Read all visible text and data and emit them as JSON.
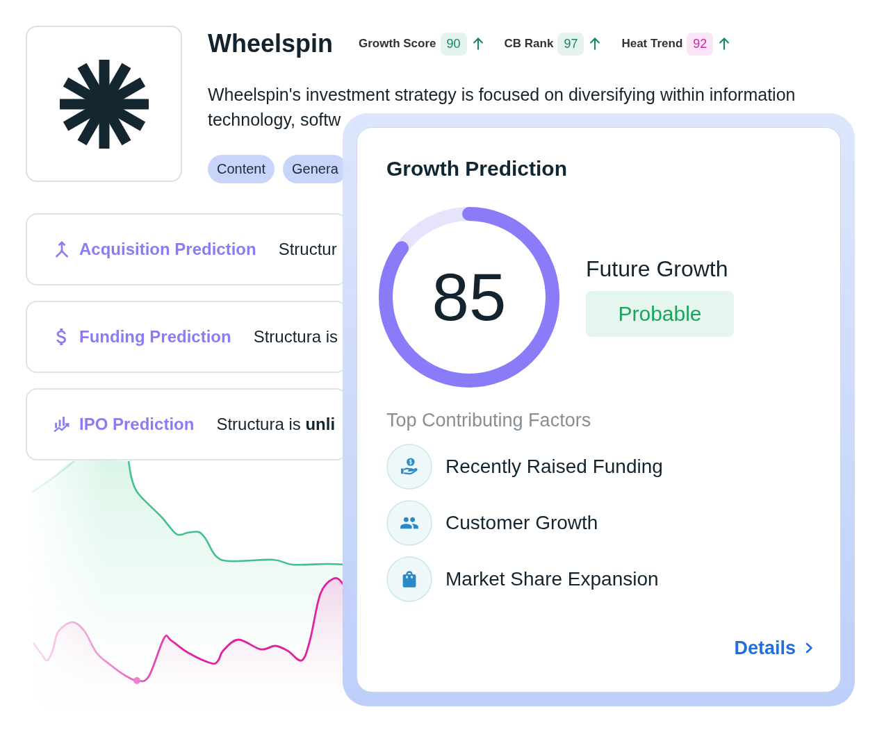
{
  "company": {
    "name": "Wheelspin",
    "metrics": [
      {
        "label": "Growth Score",
        "value": "90",
        "color": "#12885a"
      },
      {
        "label": "CB Rank",
        "value": "97",
        "color": "#12885a"
      },
      {
        "label": "Heat Trend",
        "value": "92",
        "color": "#d41fae"
      }
    ],
    "description": "Wheelspin's investment strategy is focused on diversifying within information technology, softw",
    "tags": [
      "Content",
      "Genera"
    ]
  },
  "predictions": [
    {
      "kind": "acquisition",
      "title": "Acquisition Prediction",
      "text": "Structur"
    },
    {
      "kind": "funding",
      "title": "Funding Prediction",
      "text": "Structura is"
    },
    {
      "kind": "ipo",
      "title": "IPO Prediction",
      "text": "Structura is **unli**"
    }
  ],
  "growth_prediction": {
    "title": "Growth Prediction",
    "score": "85",
    "level": 0.85,
    "outlook_label": "Future Growth",
    "outlook": "Probable",
    "factors_title": "Top Contributing Factors",
    "factors": [
      {
        "kind": "funding",
        "label": "Recently Raised Funding"
      },
      {
        "kind": "customers",
        "label": "Customer Growth"
      },
      {
        "kind": "market",
        "label": "Market Share Expansion"
      }
    ],
    "details_link": "Details"
  }
}
